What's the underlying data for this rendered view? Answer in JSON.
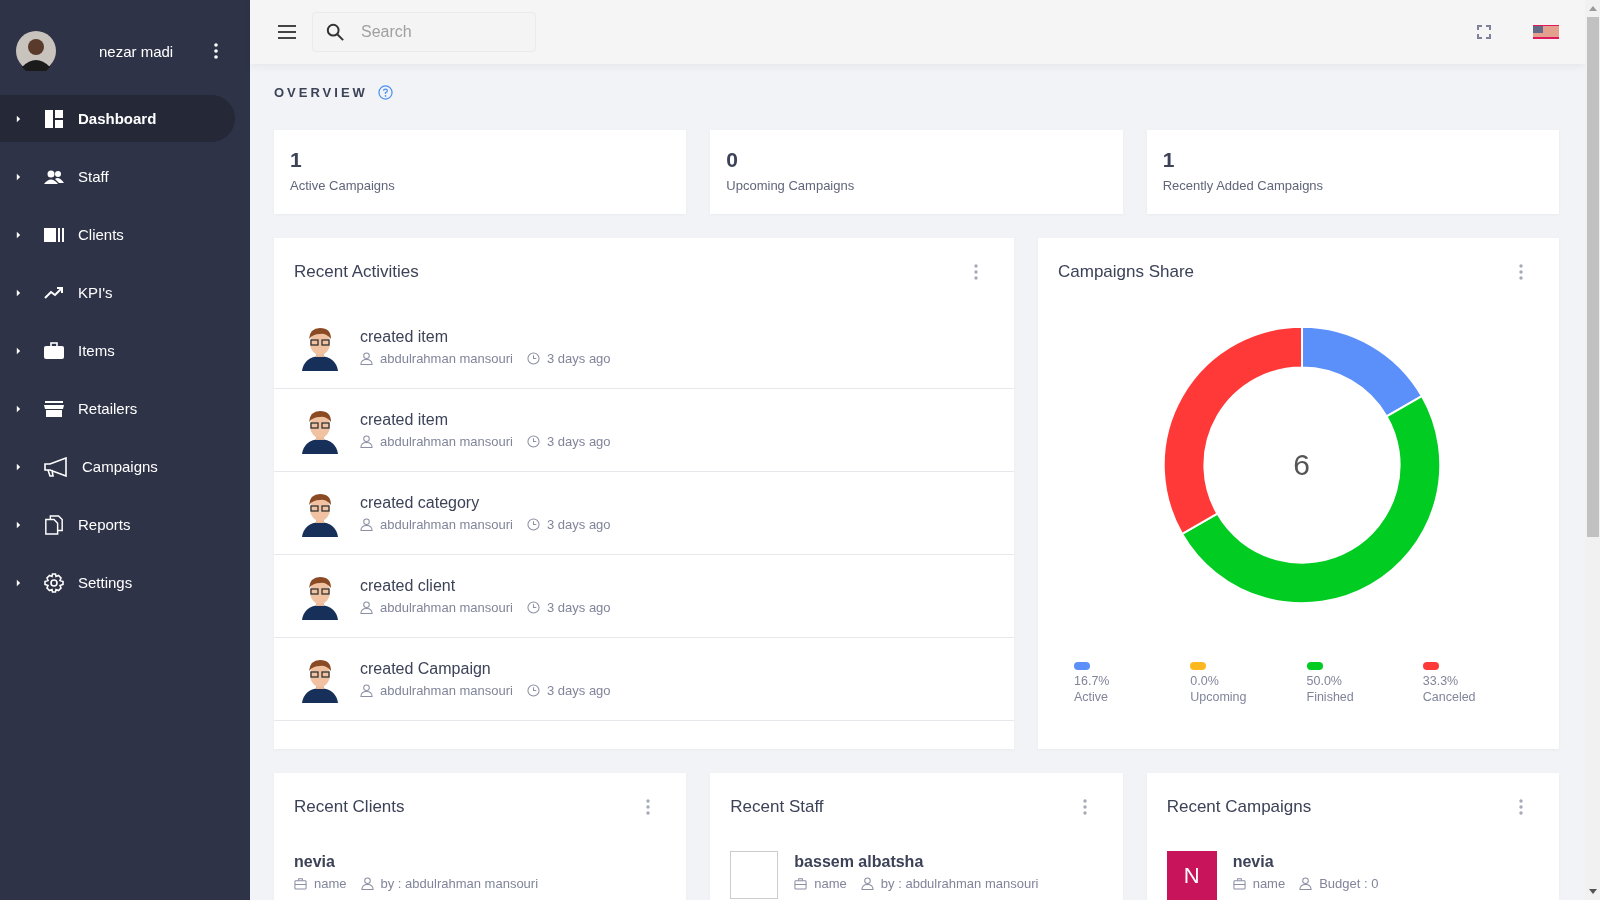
{
  "user": {
    "name": "nezar madi"
  },
  "sidebar": {
    "items": [
      {
        "label": "Dashboard",
        "selected": true
      },
      {
        "label": "Staff",
        "selected": false
      },
      {
        "label": "Clients",
        "selected": false
      },
      {
        "label": "KPI's",
        "selected": false
      },
      {
        "label": "Items",
        "selected": false
      },
      {
        "label": "Retailers",
        "selected": false
      },
      {
        "label": "Campaigns",
        "selected": false
      },
      {
        "label": "Reports",
        "selected": false
      },
      {
        "label": "Settings",
        "selected": false
      }
    ]
  },
  "search": {
    "placeholder": "Search"
  },
  "overview": {
    "title": "OVERVIEW"
  },
  "stats": [
    {
      "value": "1",
      "label": "Active Campaigns"
    },
    {
      "value": "0",
      "label": "Upcoming Campaigns"
    },
    {
      "value": "1",
      "label": "Recently Added Campaigns"
    }
  ],
  "recent_activities": {
    "title": "Recent Activities",
    "items": [
      {
        "action": "created item",
        "user": "abdulrahman mansouri",
        "time": "3 days ago"
      },
      {
        "action": "created item",
        "user": "abdulrahman mansouri",
        "time": "3 days ago"
      },
      {
        "action": "created category",
        "user": "abdulrahman mansouri",
        "time": "3 days ago"
      },
      {
        "action": "created client",
        "user": "abdulrahman mansouri",
        "time": "3 days ago"
      },
      {
        "action": "created Campaign",
        "user": "abdulrahman mansouri",
        "time": "3 days ago"
      }
    ]
  },
  "campaigns_share": {
    "title": "Campaigns Share",
    "total": "6",
    "chart_data": {
      "type": "donut",
      "categories": [
        "Active",
        "Upcoming",
        "Finished",
        "Canceled"
      ],
      "values": [
        16.7,
        0.0,
        50.0,
        33.3
      ]
    },
    "legend": [
      {
        "percent": "16.7%",
        "color": "#5b8ff9"
      },
      {
        "percent": "0.0%",
        "color": "#fbb91f"
      },
      {
        "percent": "50.0%",
        "color": "#00cc22"
      },
      {
        "percent": "33.3%",
        "color": "#ff3838"
      }
    ]
  },
  "bottom_cards": [
    {
      "kind": "client",
      "title": "Recent Clients",
      "name": "nevia",
      "meta_1": "name",
      "meta_2": "by : abdulrahman mansouri"
    },
    {
      "kind": "staff",
      "title": "Recent Staff",
      "name": "bassem albatsha",
      "meta_1": "name",
      "meta_2": "by : abdulrahman mansouri"
    },
    {
      "kind": "campaign",
      "title": "Recent Campaigns",
      "name": "nevia",
      "initial": "N",
      "meta_1": "name",
      "meta_2": "Budget : 0"
    }
  ]
}
